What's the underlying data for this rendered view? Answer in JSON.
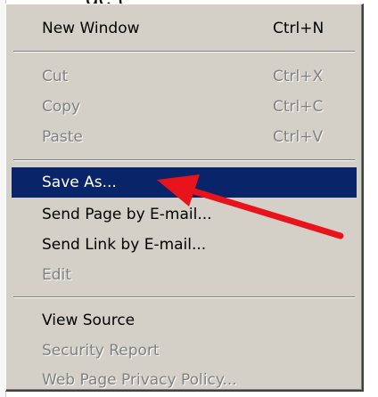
{
  "background": {
    "title_fragment": "ge ("
  },
  "menu": {
    "items": [
      {
        "label": "New Window",
        "shortcut": "Ctrl+N",
        "enabled": true,
        "highlighted": false
      },
      {
        "label": "Cut",
        "shortcut": "Ctrl+X",
        "enabled": false,
        "highlighted": false
      },
      {
        "label": "Copy",
        "shortcut": "Ctrl+C",
        "enabled": false,
        "highlighted": false
      },
      {
        "label": "Paste",
        "shortcut": "Ctrl+V",
        "enabled": false,
        "highlighted": false
      },
      {
        "label": "Save As...",
        "shortcut": "",
        "enabled": true,
        "highlighted": true
      },
      {
        "label": "Send Page by E-mail...",
        "shortcut": "",
        "enabled": true,
        "highlighted": false
      },
      {
        "label": "Send Link by E-mail...",
        "shortcut": "",
        "enabled": true,
        "highlighted": false
      },
      {
        "label": "Edit",
        "shortcut": "",
        "enabled": false,
        "highlighted": false
      },
      {
        "label": "View Source",
        "shortcut": "",
        "enabled": true,
        "highlighted": false
      },
      {
        "label": "Security Report",
        "shortcut": "",
        "enabled": false,
        "highlighted": false
      },
      {
        "label": "Web Page Privacy Policy...",
        "shortcut": "",
        "enabled": false,
        "highlighted": false
      }
    ]
  },
  "colors": {
    "menu_background": "#d4d0c8",
    "highlight": "#0a246a",
    "disabled_text": "#808080",
    "annotation_arrow": "#e8141c"
  },
  "annotation": {
    "icon": "red-arrow-icon",
    "points_to": "Save As..."
  }
}
